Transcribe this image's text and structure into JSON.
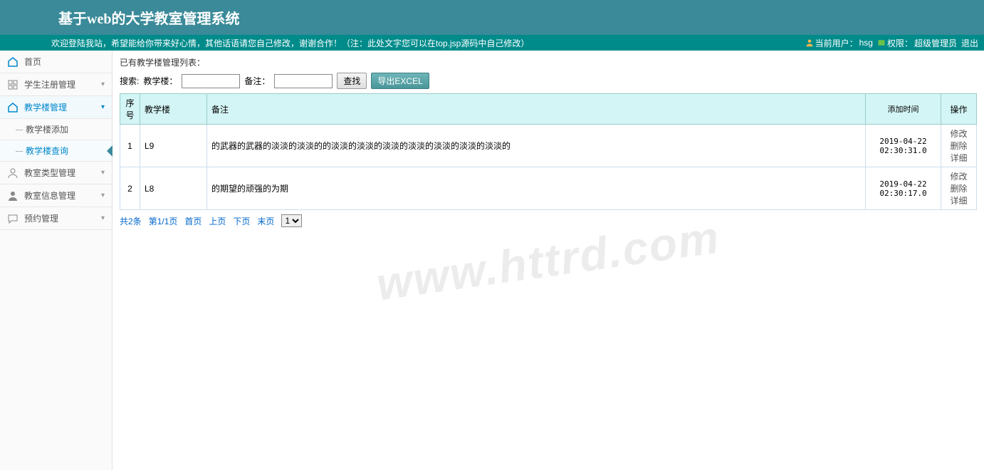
{
  "header": {
    "title": "基于web的大学教室管理系统",
    "welcome": "欢迎登陆我站，希望能给你带来好心情，其他话语请您自己修改，谢谢合作！（注：此处文字您可以在top.jsp源码中自己修改）",
    "current_user_label": "当前用户：",
    "current_user": "hsg",
    "role_label": "权限：",
    "role": "超级管理员",
    "logout": "退出"
  },
  "sidebar": {
    "home": "首页",
    "student": "学生注册管理",
    "building": "教学楼管理",
    "building_add": "教学楼添加",
    "building_query": "教学楼查询",
    "room_type": "教室类型管理",
    "room_info": "教室信息管理",
    "booking": "预约管理"
  },
  "main": {
    "list_title": "已有教学楼管理列表：",
    "search_label": "搜索:",
    "building_label": "教学楼：",
    "remark_label": "备注：",
    "search_btn": "查找",
    "export_btn": "导出EXCEL",
    "columns": {
      "seq": "序号",
      "building": "教学楼",
      "remark": "备注",
      "add_time": "添加时间",
      "op": "操作"
    },
    "rows": [
      {
        "seq": "1",
        "building": "L9",
        "remark": "的武器的武器的淡淡的淡淡的的淡淡的淡淡的淡淡的淡淡的淡淡的淡淡的淡淡的",
        "time": "2019-04-22 02:30:31.0",
        "op_edit": "修改",
        "op_del": "删除",
        "op_detail": "详细"
      },
      {
        "seq": "2",
        "building": "L8",
        "remark": "的期望的顽强的为期",
        "time": "2019-04-22 02:30:17.0",
        "op_edit": "修改",
        "op_del": "删除",
        "op_detail": "详细"
      }
    ],
    "pagination": {
      "total": "共2条",
      "page_info": "第1/1页",
      "first": "首页",
      "prev": "上页",
      "next": "下页",
      "last": "末页",
      "select_value": "1"
    }
  },
  "watermark": "www.httrd.com"
}
